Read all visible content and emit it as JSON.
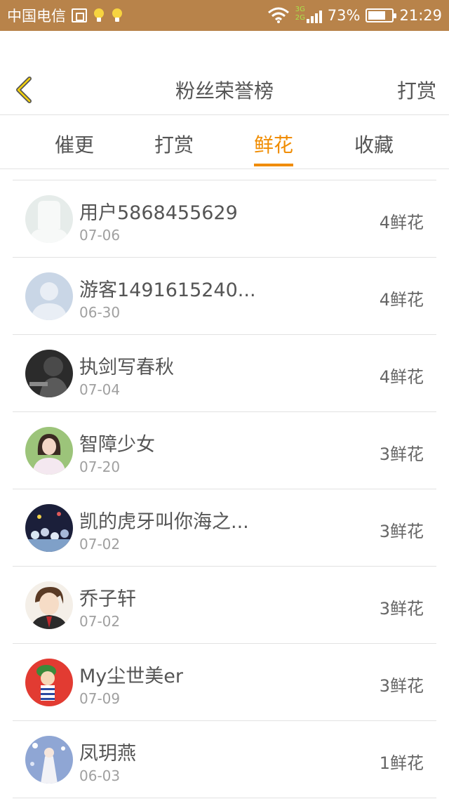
{
  "status": {
    "carrier": "中国电信",
    "net_top": "3G",
    "net_bottom": "2G",
    "battery": "73%",
    "battery_level": 0.73,
    "time": "21:29"
  },
  "nav": {
    "title": "粉丝荣誉榜",
    "action": "打赏"
  },
  "tabs": [
    {
      "label": "催更",
      "active": false
    },
    {
      "label": "打赏",
      "active": false
    },
    {
      "label": "鲜花",
      "active": true
    },
    {
      "label": "收藏",
      "active": false
    }
  ],
  "colors": {
    "accent": "#f08c00",
    "statusbar": "#b8834a"
  },
  "fans": [
    {
      "name": "用户5868455629",
      "date": "07-06",
      "flowers": "4鲜花",
      "avatar": "default-white-avatar"
    },
    {
      "name": "游客1491615240...",
      "date": "06-30",
      "flowers": "4鲜花",
      "avatar": "default-blue-avatar"
    },
    {
      "name": "执剑写春秋",
      "date": "07-04",
      "flowers": "4鲜花",
      "avatar": "dark-photo-avatar"
    },
    {
      "name": "智障少女",
      "date": "07-20",
      "flowers": "3鲜花",
      "avatar": "girl-photo-avatar"
    },
    {
      "name": "凯的虎牙叫你海之...",
      "date": "07-02",
      "flowers": "3鲜花",
      "avatar": "crowd-photo-avatar"
    },
    {
      "name": "乔子轩",
      "date": "07-02",
      "flowers": "3鲜花",
      "avatar": "anime-boy-avatar"
    },
    {
      "name": "My尘世美er",
      "date": "07-09",
      "flowers": "3鲜花",
      "avatar": "red-cartoon-avatar"
    },
    {
      "name": "凤玥燕",
      "date": "06-03",
      "flowers": "1鲜花",
      "avatar": "blue-illustration-avatar"
    }
  ]
}
